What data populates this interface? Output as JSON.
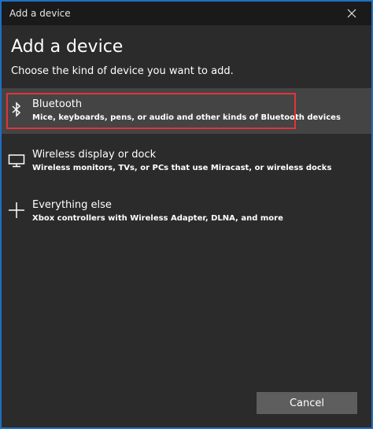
{
  "window": {
    "title": "Add a device"
  },
  "page": {
    "heading": "Add a device",
    "subheading": "Choose the kind of device you want to add."
  },
  "options": [
    {
      "title": "Bluetooth",
      "description": "Mice, keyboards, pens, or audio and other kinds of Bluetooth devices",
      "icon": "bluetooth-icon",
      "selected": true
    },
    {
      "title": "Wireless display or dock",
      "description": "Wireless monitors, TVs, or PCs that use Miracast, or wireless docks",
      "icon": "monitor-icon",
      "selected": false
    },
    {
      "title": "Everything else",
      "description": "Xbox controllers with Wireless Adapter, DLNA, and more",
      "icon": "plus-icon",
      "selected": false
    }
  ],
  "footer": {
    "cancel_label": "Cancel"
  },
  "colors": {
    "background": "#2b2b2b",
    "titlebar": "#1a1a1a",
    "selected_row": "#444444",
    "highlight_border": "#e0343a",
    "window_border": "#1f6fc2",
    "button": "#5e5e5e"
  }
}
